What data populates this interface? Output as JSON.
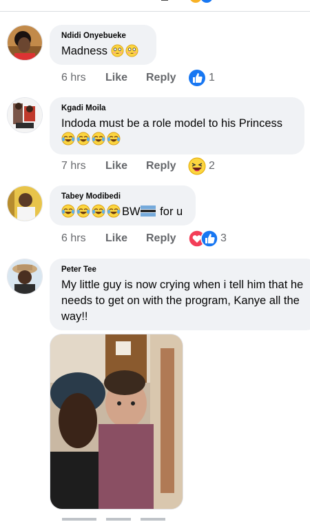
{
  "comments": [
    {
      "author": "Ndidi Onyebueke",
      "text": "Madness",
      "emojis": [
        "flushed-face-emoji",
        "flushed-face-emoji"
      ],
      "time": "6 hrs",
      "like_label": "Like",
      "reply_label": "Reply",
      "reaction_count": "1"
    },
    {
      "author": "Kgadi Moila",
      "text": "Indoda must be a role model to his Princess",
      "emojis": [
        "tears-of-joy-emoji",
        "tears-of-joy-emoji",
        "tears-of-joy-emoji",
        "tears-of-joy-emoji"
      ],
      "time": "7 hrs",
      "like_label": "Like",
      "reply_label": "Reply",
      "reaction_count": "2"
    },
    {
      "author": "Tabey Modibedi",
      "text_suffix": "BW",
      "text_end": " for u",
      "emojis": [
        "tears-of-joy-emoji",
        "tears-of-joy-emoji",
        "tears-of-joy-emoji",
        "tears-of-joy-emoji",
        "botswana-flag-emoji"
      ],
      "time": "6 hrs",
      "like_label": "Like",
      "reply_label": "Reply",
      "reaction_count": "3"
    },
    {
      "author": "Peter Tee",
      "text": "My little guy is now crying when i tell him that he needs to get on with the program, Kanye all the way!!"
    }
  ],
  "colors": {
    "bubble": "#f0f2f5",
    "meta": "#65676b",
    "like_blue": "#1877f2",
    "love_red": "#f33e58",
    "haha_yellow": "#fcd53f"
  }
}
